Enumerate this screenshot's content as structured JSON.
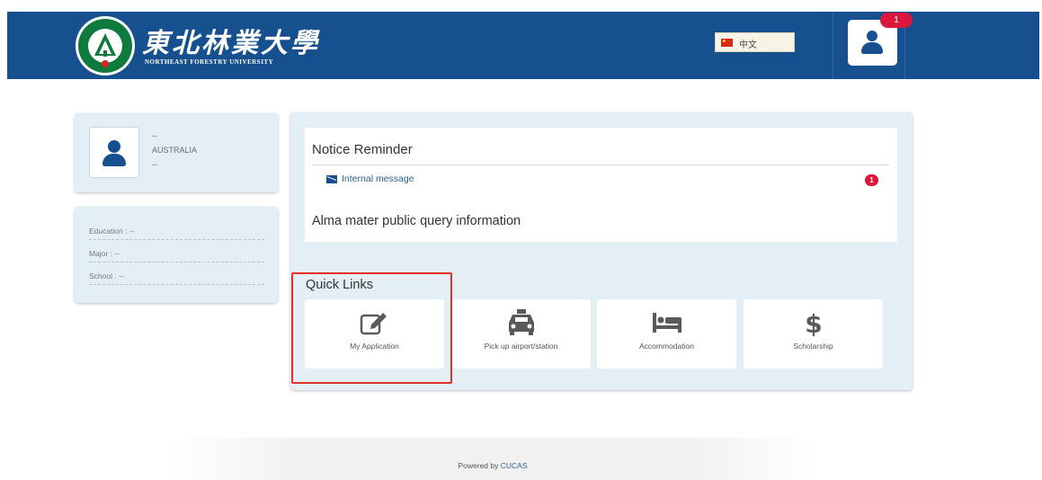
{
  "header": {
    "logo_cn": "東北林業大學",
    "logo_en": "NORTHEAST FORESTRY UNIVERSITY",
    "language_label": "中文",
    "notification_count": "1"
  },
  "profile": {
    "line1": "--",
    "country": "AUSTRALIA",
    "line3": "--"
  },
  "info": {
    "education": "Education : --",
    "major": "Major : --",
    "school": "School : --"
  },
  "notice": {
    "title": "Notice Reminder",
    "message_label": "Internal message",
    "message_count": "1",
    "alma_title": "Alma mater public query information"
  },
  "quick_links": {
    "title": "Quick Links",
    "items": [
      {
        "label": "My Application",
        "icon": "edit-icon"
      },
      {
        "label": "Pick up airport/station",
        "icon": "taxi-icon"
      },
      {
        "label": "Accommodation",
        "icon": "bed-icon"
      },
      {
        "label": "Scholarship",
        "icon": "dollar-icon"
      }
    ]
  },
  "footer": {
    "prefix": "Powered by",
    "brand": "CUCAS"
  },
  "colors": {
    "header_bg": "#17508f",
    "panel_bg": "#e3eef5",
    "badge": "#d9183b",
    "highlight": "#e0302a"
  }
}
